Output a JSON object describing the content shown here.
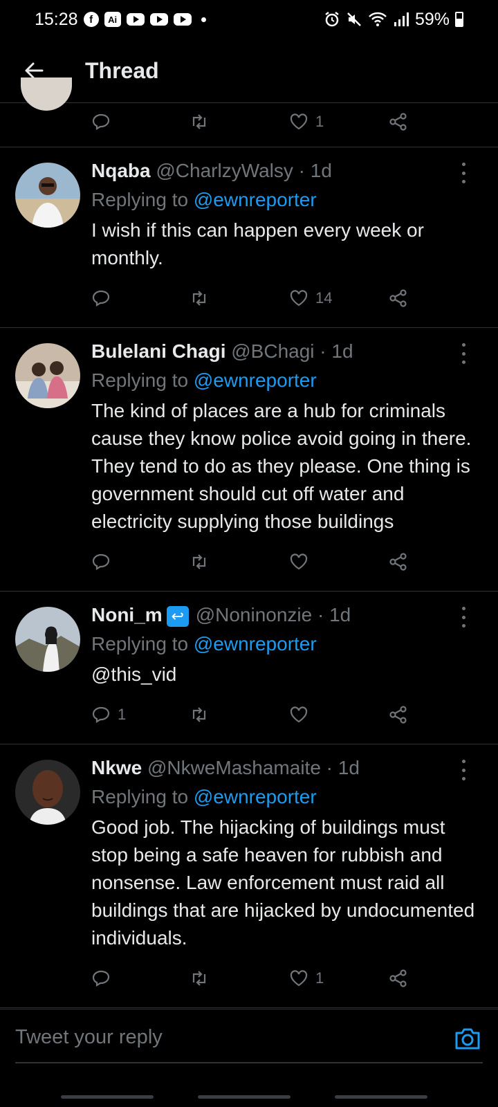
{
  "status_bar": {
    "time": "15:28",
    "app_badge": "Ai",
    "battery": "59%"
  },
  "header": {
    "title": "Thread"
  },
  "tweets": [
    {
      "name": "Nqaba",
      "handle": "@CharlzyWalsy",
      "time": "1d",
      "replying_prefix": "Replying to",
      "replying_to": "@ewnreporter",
      "text": "I wish if this can happen every week or monthly.",
      "replies": "",
      "likes": "14"
    },
    {
      "name": "Bulelani Chagi",
      "handle": "@BChagi",
      "time": "1d",
      "replying_prefix": "Replying to",
      "replying_to": "@ewnreporter",
      "text": "The kind of places are a hub for criminals cause they know police avoid going in there. They tend to do as they please. One thing is government should cut off water and electricity supplying those buildings",
      "replies": "",
      "likes": ""
    },
    {
      "name": "Noni_m",
      "handle": "@Noninonzie",
      "time": "1d",
      "replying_prefix": "Replying to",
      "replying_to": "@ewnreporter",
      "text": "@this_vid",
      "replies": "1",
      "likes": ""
    },
    {
      "name": "Nkwe",
      "handle": "@NkweMashamaite",
      "time": "1d",
      "replying_prefix": "Replying to",
      "replying_to": "@ewnreporter",
      "text": "Good job. The hijacking of buildings must stop being a safe heaven for rubbish and nonsense. Law enforcement must raid all buildings that are hijacked by undocumented individuals.",
      "replies": "",
      "likes": "1"
    }
  ],
  "partial_tweet": {
    "likes": "1"
  },
  "reply_box": {
    "placeholder": "Tweet your reply"
  },
  "colors": {
    "background": "#000000",
    "accent": "#1d9bf0",
    "muted": "#71767b",
    "divider": "#2f3336"
  }
}
